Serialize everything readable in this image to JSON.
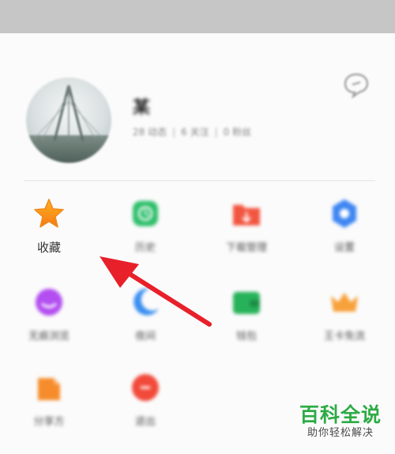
{
  "profile": {
    "name": "某",
    "stats": [
      "28 动态",
      "6 关注",
      "0 粉丝"
    ]
  },
  "menu": [
    {
      "label": "收藏",
      "icon": "star-icon",
      "color": "#f6a21c"
    },
    {
      "label": "历史",
      "icon": "history-icon",
      "color": "#2fbf6b"
    },
    {
      "label": "下载管理",
      "icon": "download-folder-icon",
      "color": "#f2553f"
    },
    {
      "label": "设置",
      "icon": "settings-icon",
      "color": "#3f86f2"
    },
    {
      "label": "无痕浏览",
      "icon": "incognito-icon",
      "color": "#b34ef0"
    },
    {
      "label": "夜间",
      "icon": "moon-icon",
      "color": "#3a8ff0"
    },
    {
      "label": "钱包",
      "icon": "wallet-icon",
      "color": "#27b25a"
    },
    {
      "label": "王卡免流",
      "icon": "crown-icon",
      "color": "#f7a13a"
    },
    {
      "label": "分享方",
      "icon": "share-icon",
      "color": "#f68c2c"
    },
    {
      "label": "退出",
      "icon": "exit-icon",
      "color": "#f24a3a"
    }
  ],
  "watermark": {
    "title": "百科全说",
    "subtitle": "助你轻松解决"
  }
}
